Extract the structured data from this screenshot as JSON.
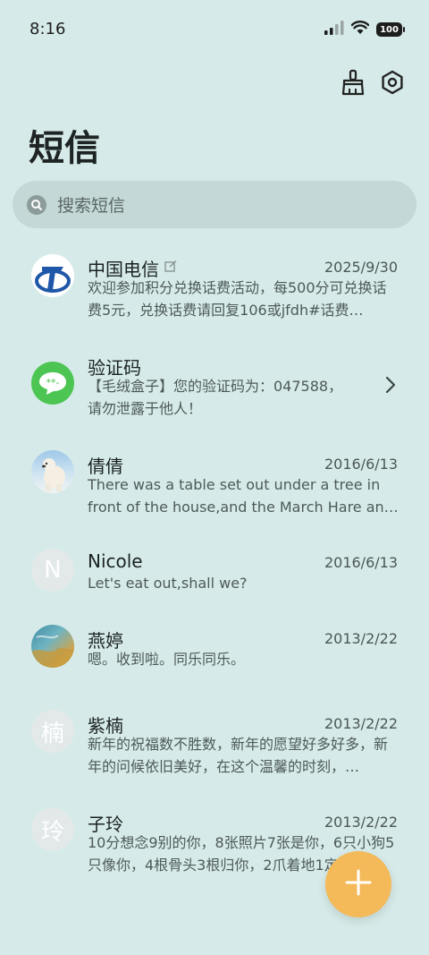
{
  "status_bar": {
    "time": "8:16",
    "battery": "100"
  },
  "header": {
    "title": "短信",
    "clean_icon": "broom-icon",
    "settings_icon": "gear-icon"
  },
  "search": {
    "placeholder": "搜索短信"
  },
  "conversations": [
    {
      "name": "中国电信",
      "date": "2025/9/30",
      "preview": "欢迎参加积分兑换话费活动，每500分可兑换话费5元，兑换话费请回复106或jfdh#话费…",
      "avatar": "china-telecom-logo"
    },
    {
      "name": "验证码",
      "date": "",
      "preview": "【毛绒盒子】您的验证码为：047588，请勿泄露于他人！",
      "avatar": "message-icon"
    },
    {
      "name": "倩倩",
      "date": "2016/6/13",
      "preview": "There was a table set out under a tree in front of the house,and the March Hare an…",
      "avatar": "polar-bear-photo"
    },
    {
      "name": "Nicole",
      "date": "2016/6/13",
      "preview": "Let's eat out,shall we?",
      "avatar_letter": "N"
    },
    {
      "name": "燕婷",
      "date": "2013/2/22",
      "preview": "嗯。收到啦。同乐同乐。",
      "avatar": "landscape-photo"
    },
    {
      "name": "紫楠",
      "date": "2013/2/22",
      "preview": "新年的祝福数不胜数，新年的愿望好多好多，新年的问候依旧美好，在这个温馨的时刻，…",
      "avatar_letter": "楠"
    },
    {
      "name": "子玲",
      "date": "2013/2/22",
      "preview": "10分想念9别的你，8张照片7张是你，6只小狗5只像你，4根骨头3根归你，2爪着地1定…",
      "avatar_letter": "玲"
    }
  ],
  "colors": {
    "background": "#d6ebe9",
    "search_bg": "#c4d9d7",
    "fab": "#f4b959",
    "message_green": "#4cc552",
    "telecom_blue": "#1f57a8"
  },
  "fab": {
    "icon": "plus-icon"
  }
}
